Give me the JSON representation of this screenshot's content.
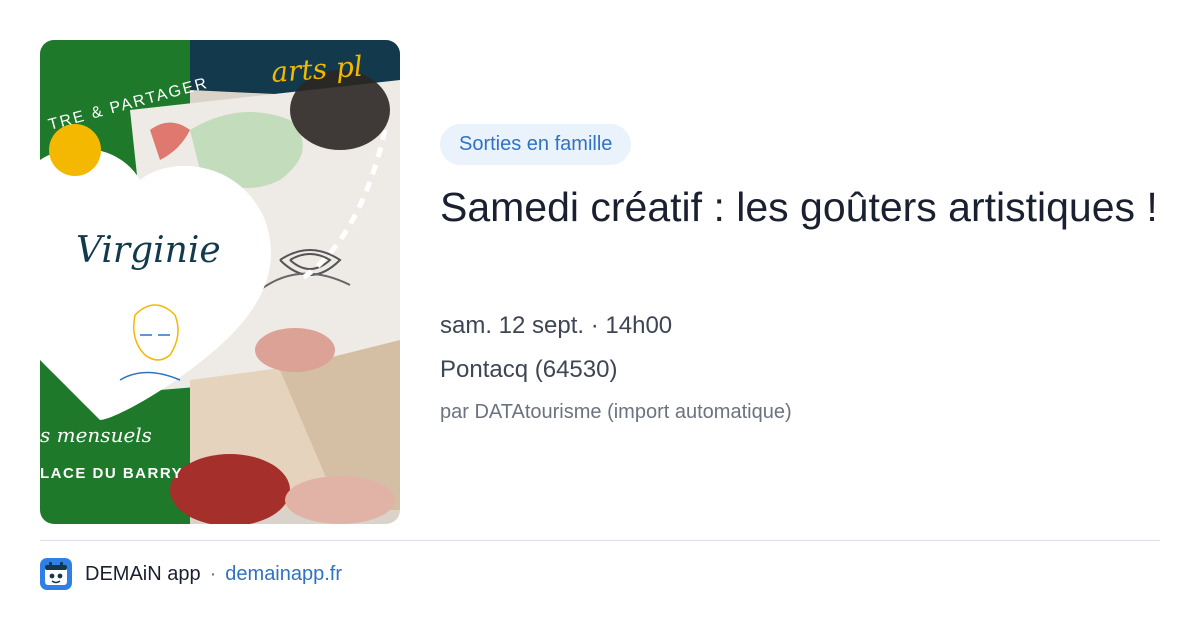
{
  "event": {
    "category": "Sorties en famille",
    "title": "Samedi créatif : les goûters artistiques !",
    "datetime": "sam. 12 sept. · 14h00",
    "location": "Pontacq (64530)",
    "source": "par DATAtourisme (import automatique)"
  },
  "poster": {
    "headline_partial": "arts pl",
    "tagline_partial": "TRE & PARTAGER",
    "name": "Virginie",
    "schedule_partial": "s mensuels",
    "venue_partial": "LACE DU BARRY",
    "colors": {
      "green": "#1e7a2a",
      "navy": "#123a4c",
      "yellow": "#f5b800",
      "paper": "#e8e2d8"
    }
  },
  "footer": {
    "app_name": "DEMAiN app",
    "separator": "·",
    "url": "demainapp.fr",
    "icon": "demain-app-icon"
  },
  "colors": {
    "accent": "#2f72c4",
    "badge_bg": "#eaf2fc",
    "title": "#1a2030",
    "muted": "#6b7380"
  }
}
